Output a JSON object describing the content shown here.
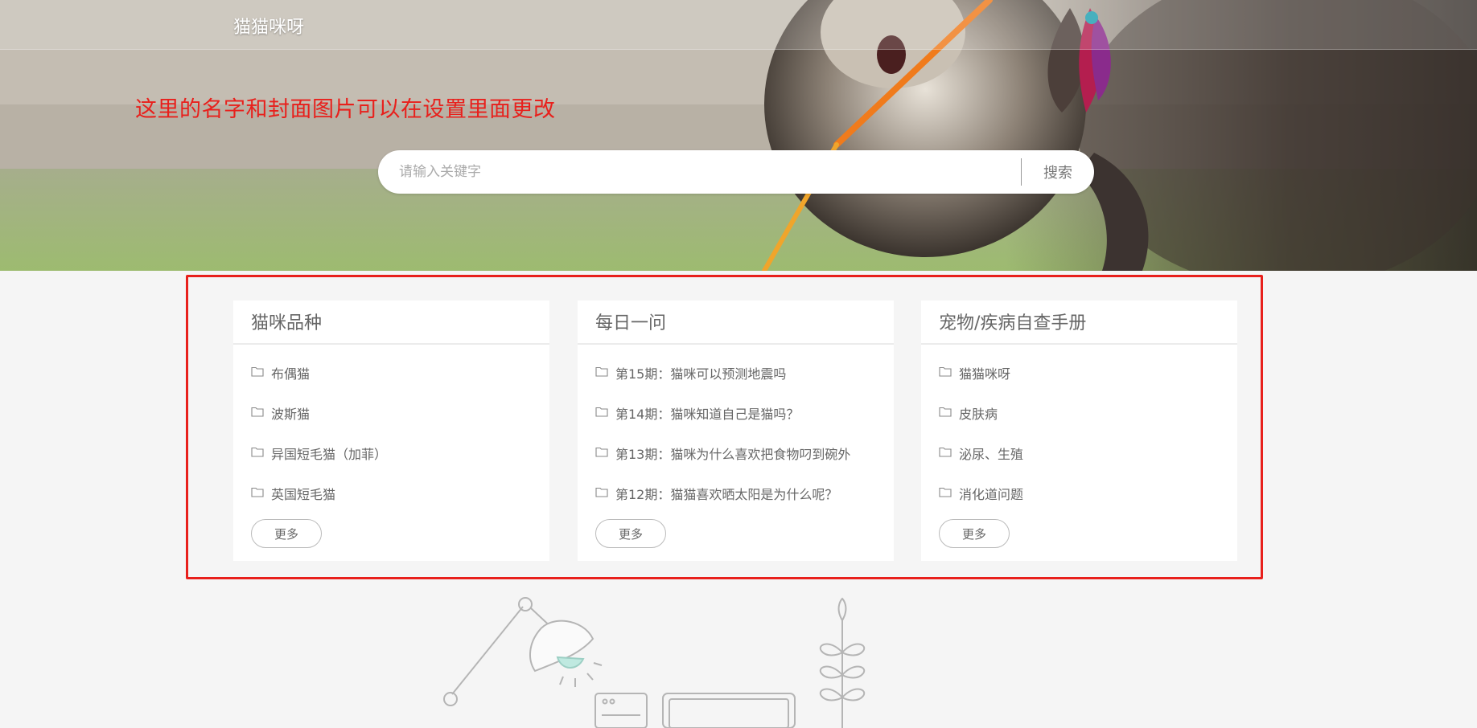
{
  "header": {
    "site_title": "猫猫咪呀",
    "annotation": "这里的名字和封面图片可以在设置里面更改"
  },
  "search": {
    "placeholder": "请输入关键字",
    "button_label": "搜索"
  },
  "cards": [
    {
      "title": "猫咪品种",
      "items": [
        "布偶猫",
        "波斯猫",
        "异国短毛猫（加菲）",
        "英国短毛猫"
      ],
      "more_label": "更多"
    },
    {
      "title": "每日一问",
      "items": [
        "第15期：猫咪可以预测地震吗",
        "第14期：猫咪知道自己是猫吗？",
        "第13期：猫咪为什么喜欢把食物叼到碗外",
        "第12期：猫猫喜欢晒太阳是为什么呢？"
      ],
      "more_label": "更多"
    },
    {
      "title": "宠物/疾病自查手册",
      "items": [
        "猫猫咪呀",
        "皮肤病",
        "泌尿、生殖",
        "消化道问题"
      ],
      "more_label": "更多"
    }
  ],
  "icons": {
    "list_item": "folder-icon",
    "illustration": [
      "desk-lamp-icon",
      "computer-icon",
      "plant-icon"
    ]
  },
  "colors": {
    "annotation_red": "#e8201c",
    "page_bg": "#f5f5f5",
    "card_bg": "#ffffff"
  }
}
